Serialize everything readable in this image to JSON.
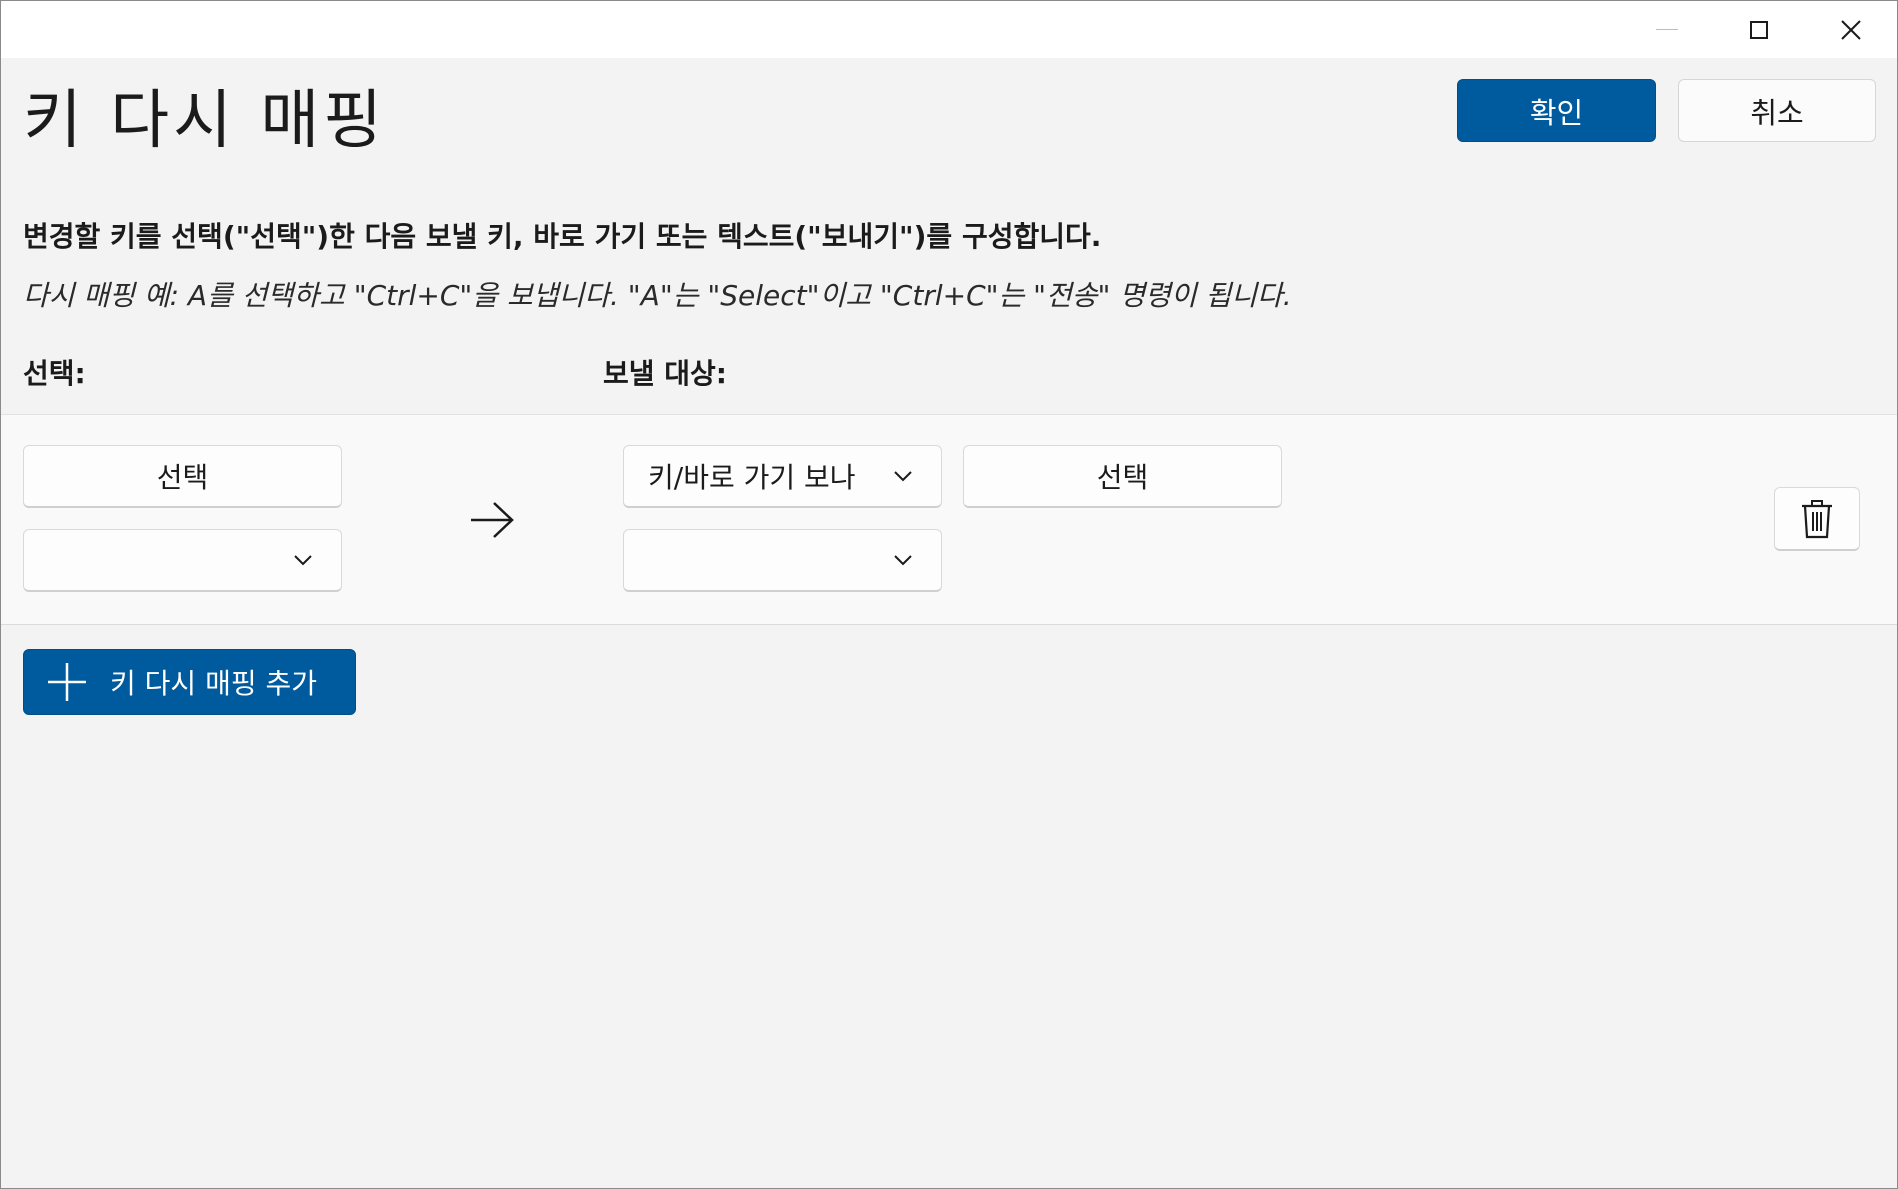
{
  "window": {
    "controls": {
      "minimize_icon": "minimize-icon",
      "maximize_icon": "maximize-icon",
      "close_icon": "close-icon"
    }
  },
  "header": {
    "title": "키 다시 매핑",
    "ok_label": "확인",
    "cancel_label": "취소"
  },
  "instructions": {
    "text": "변경할 키를 선택(\"선택\")한 다음 보낼 키, 바로 가기 또는 텍스트(\"보내기\")를 구성합니다.",
    "example": "다시 매핑 예: A를 선택하고 \"Ctrl+C\"을 보냅니다. \"A\"는 \"Select\"이고 \"Ctrl+C\"는 \"전송\" 명령이 됩니다."
  },
  "columns": {
    "select_label": "선택:",
    "send_label": "보낼 대상:"
  },
  "mapping_rows": [
    {
      "select_button_label": "선택",
      "select_dropdown_value": "",
      "send_type_value": "키/바로 가기 보나",
      "send_select_button_label": "선택",
      "send_dropdown_value": ""
    }
  ],
  "add_button_label": "키 다시 매핑 추가",
  "colors": {
    "accent": "#005a9e",
    "background": "#f3f3f3",
    "row_background": "#f9f9f9"
  }
}
